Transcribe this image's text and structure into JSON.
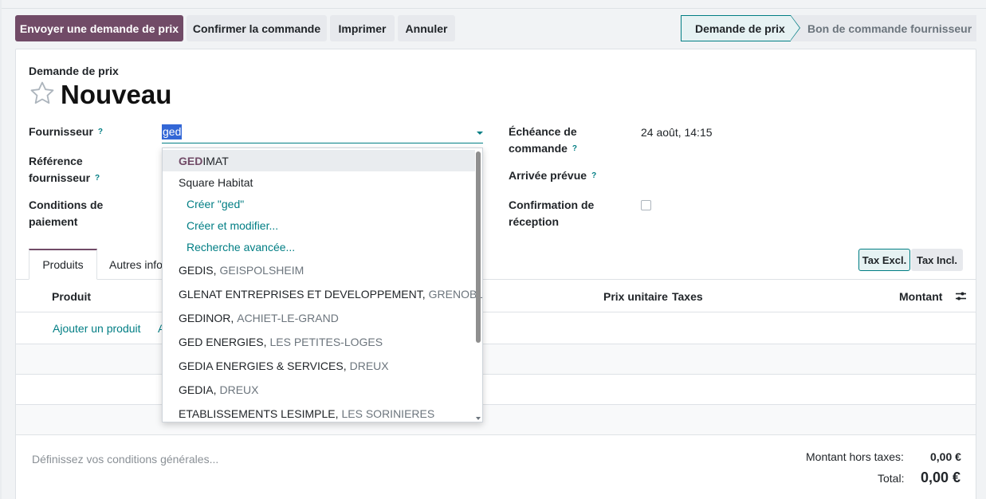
{
  "toolbar": {
    "send_rfq": "Envoyer une demande de prix",
    "confirm_order": "Confirmer la commande",
    "print": "Imprimer",
    "cancel": "Annuler"
  },
  "statusbar": {
    "active": "Demande de prix",
    "next": "Bon de commande fournisseur"
  },
  "form": {
    "doc_type": "Demande de prix",
    "title": "Nouveau",
    "supplier_label": "Fournisseur",
    "supplier_value": "ged",
    "supplier_ref_label_1": "Référence",
    "supplier_ref_label_2": "fournisseur",
    "payment_terms_label_1": "Conditions de",
    "payment_terms_label_2": "paiement",
    "deadline_label_1": "Échéance de",
    "deadline_label_2": "commande",
    "deadline_value": "24 août, 14:15",
    "expected_arrival_label": "Arrivée prévue",
    "receipt_confirm_label_1": "Confirmation de",
    "receipt_confirm_label_2": "réception",
    "help_mark": "?"
  },
  "tabs": {
    "products": "Produits",
    "other_info": "Autres info"
  },
  "tax_toggle": {
    "excl": "Tax Excl.",
    "incl": "Tax Incl."
  },
  "table": {
    "col_product": "Produit",
    "col_unit_price": "Prix unitaire",
    "col_taxes": "Taxes",
    "col_amount": "Montant",
    "add_product": "Ajouter un produit",
    "add_partial": "A"
  },
  "footer": {
    "terms_placeholder": "Définissez vos conditions générales...",
    "untaxed_label": "Montant hors taxes:",
    "untaxed_value": "0,00 €",
    "total_label": "Total:",
    "total_value": "0,00 €"
  },
  "dropdown": {
    "items": [
      {
        "match": "GED",
        "rest": "IMAT",
        "city": ""
      },
      {
        "name": "Square Habitat",
        "city": ""
      },
      {
        "action": "Créer \"ged\""
      },
      {
        "action": "Créer et modifier..."
      },
      {
        "action": "Recherche avancée..."
      },
      {
        "name": "GEDIS,",
        "city": "GEISPOLSHEIM"
      },
      {
        "name": "GLENAT ENTREPRISES ET DEVELOPPEMENT,",
        "city": "GRENOBLE"
      },
      {
        "name": "GEDINOR,",
        "city": "ACHIET-LE-GRAND"
      },
      {
        "name": "GED ENERGIES,",
        "city": "LES PETITES-LOGES"
      },
      {
        "name": "GEDIA ENERGIES & SERVICES,",
        "city": "DREUX"
      },
      {
        "name": "GEDIA,",
        "city": "DREUX"
      },
      {
        "name": "ETABLISSEMENTS LESIMPLE,",
        "city": "LES SORINIERES"
      }
    ]
  },
  "colors": {
    "primary": "#714b67",
    "accent": "#017e84"
  }
}
